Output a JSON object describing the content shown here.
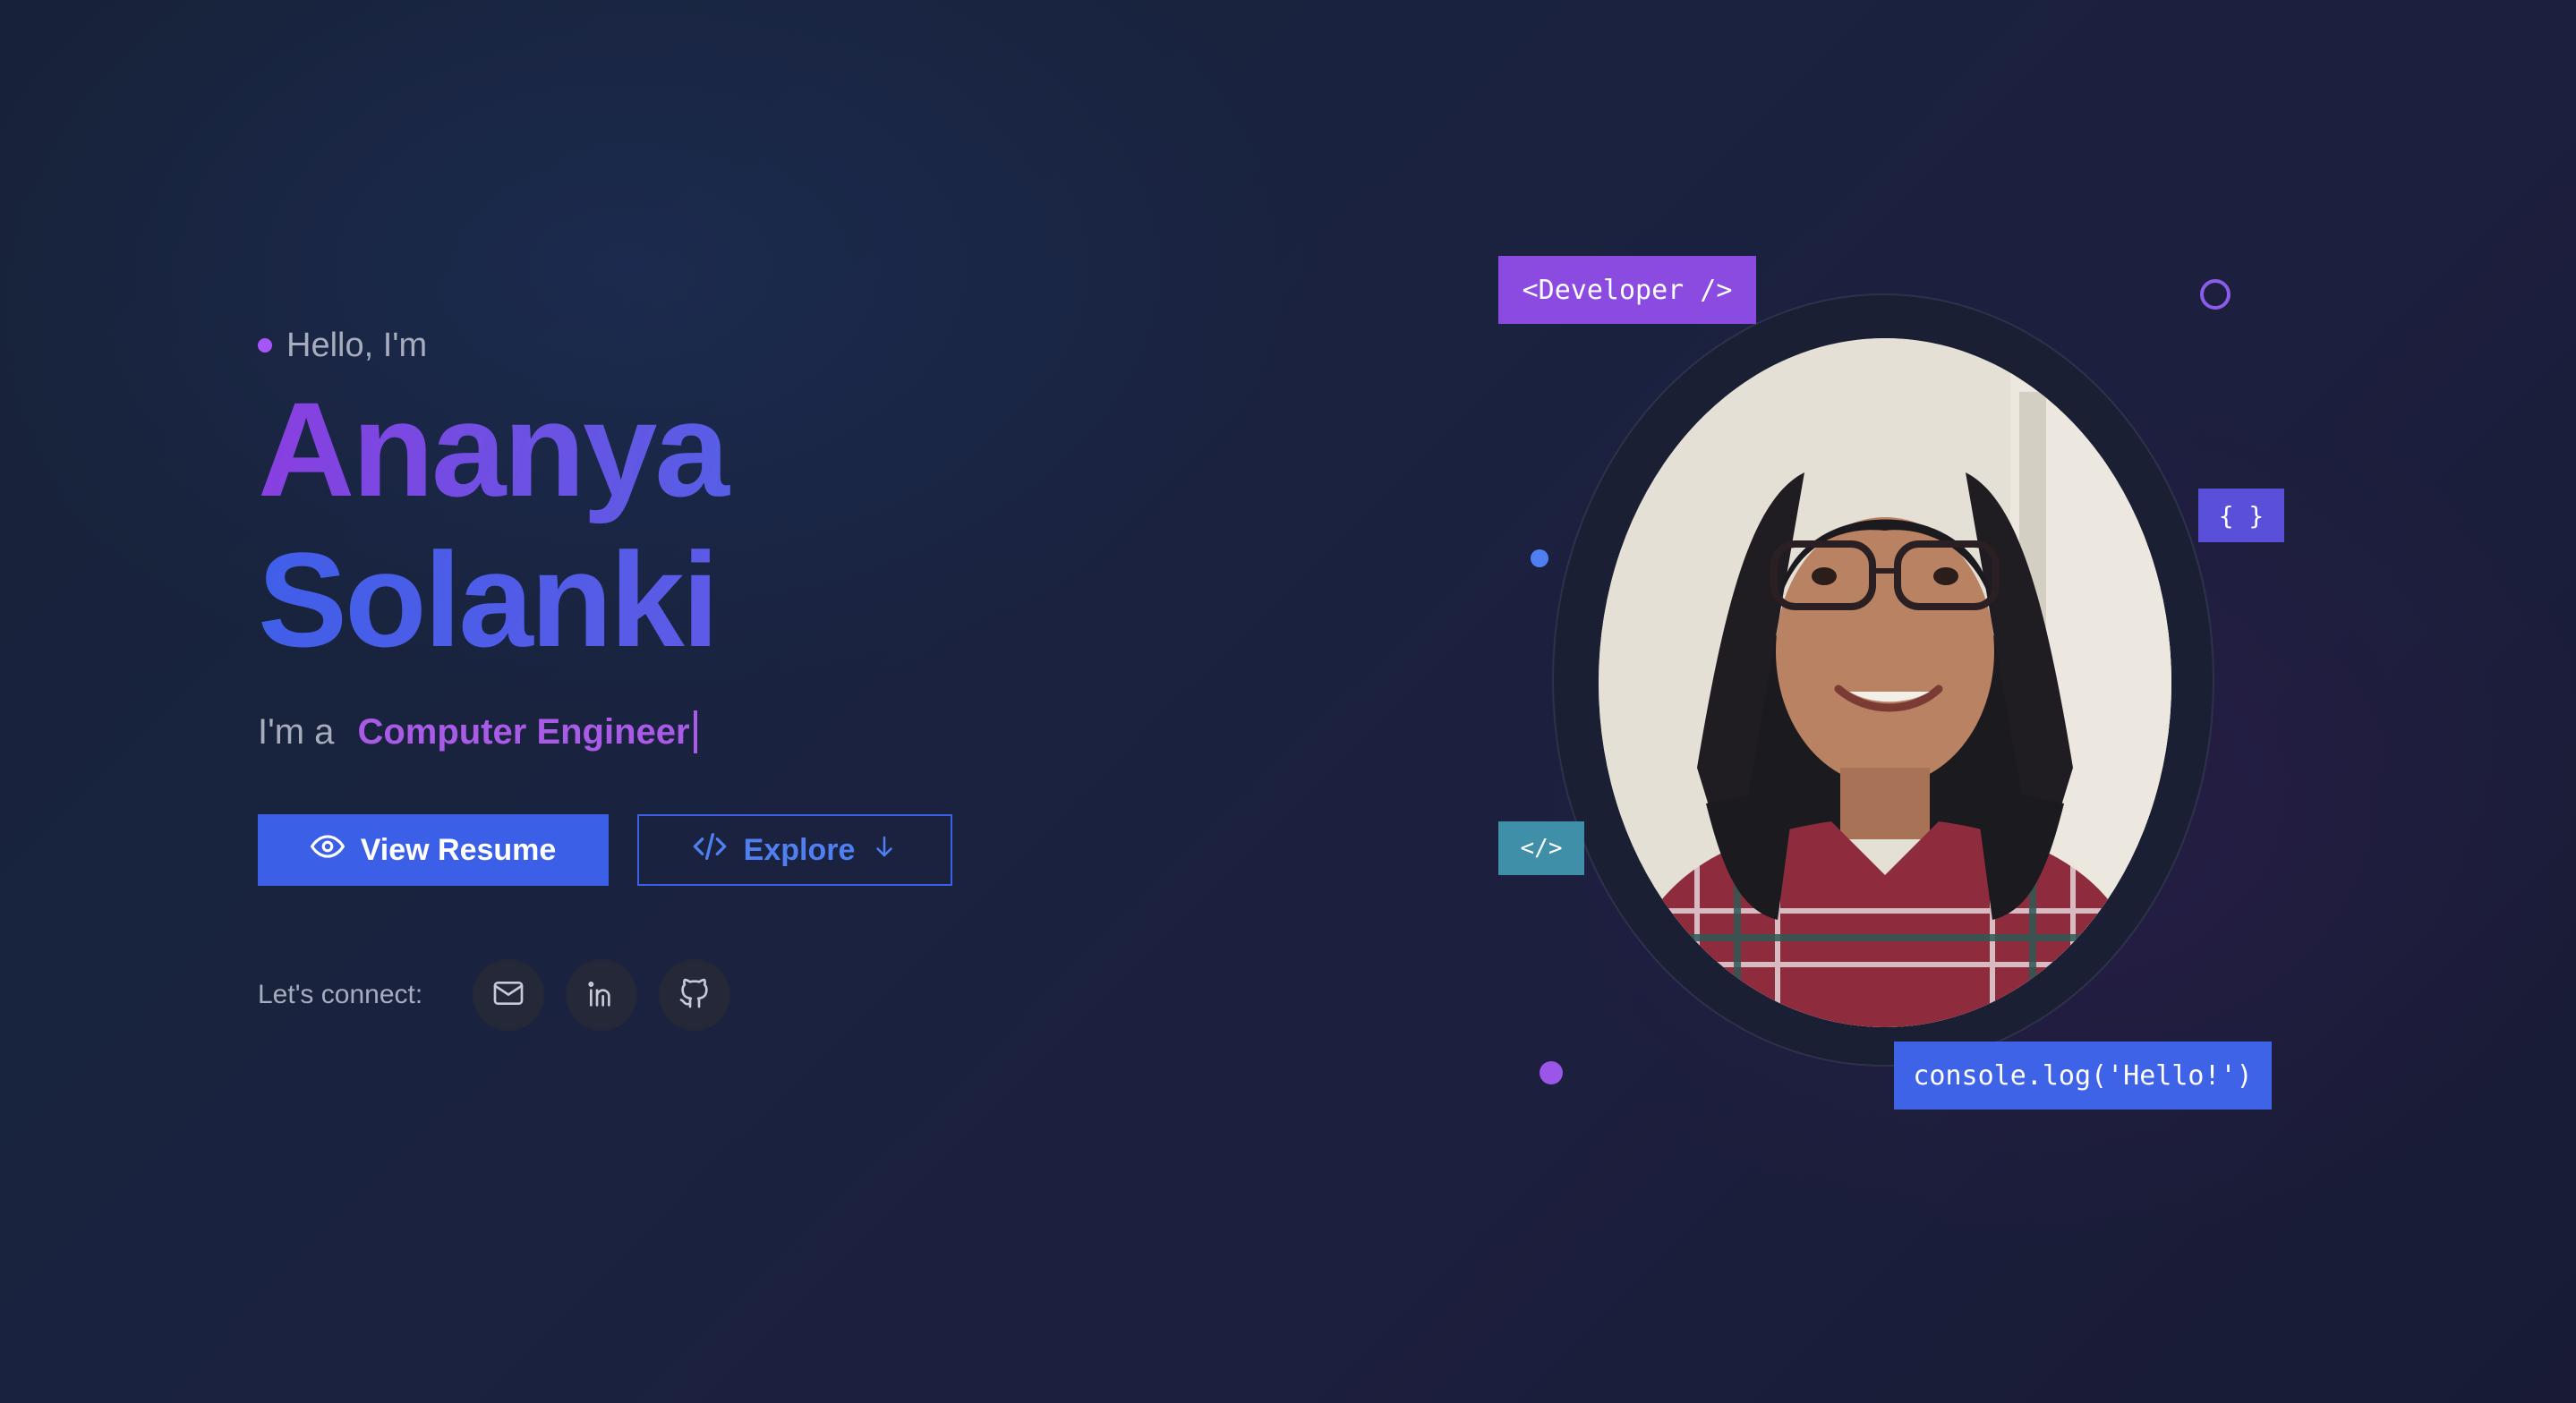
{
  "hero": {
    "greeting": "Hello, I'm",
    "first_name": "Ananya",
    "last_name": "Solanki",
    "role_prefix": "I'm a",
    "role_value": "Computer Engineer"
  },
  "actions": {
    "primary_label": "View Resume",
    "primary_icon": "eye-icon",
    "secondary_label": "Explore",
    "secondary_icon": "code-icon",
    "secondary_trailing_icon": "arrow-down-icon"
  },
  "connect": {
    "label": "Let's connect:",
    "links": [
      {
        "icon": "mail-icon"
      },
      {
        "icon": "linkedin-icon"
      },
      {
        "icon": "github-icon"
      }
    ]
  },
  "decor_tags": {
    "developer": "<Developer />",
    "braces": "{ }",
    "slash": "</>",
    "console": "console.log('Hello!')"
  },
  "colors": {
    "accent_purple": "#a855f7",
    "accent_blue": "#3b5fe6",
    "background": "#19233f"
  }
}
